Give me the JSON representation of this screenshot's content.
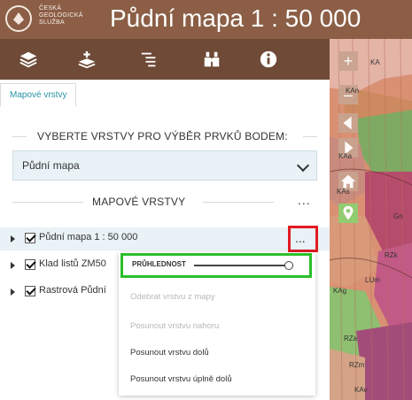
{
  "header": {
    "org_lines": [
      "ČESKÁ",
      "GEOLOGICKÁ",
      "SLUŽBA"
    ],
    "title": "Půdní mapa 1 : 50 000"
  },
  "toolbar": {
    "items": [
      {
        "icon": "layers-icon"
      },
      {
        "icon": "add-layer-icon"
      },
      {
        "icon": "legend-icon"
      },
      {
        "icon": "binoculars-icon"
      },
      {
        "icon": "info-icon"
      }
    ]
  },
  "tabs": {
    "active": "Mapové vrstvy"
  },
  "panel": {
    "select_section_title": "VYBERTE VRSTVY PRO VÝBĚR PRVKŮ BODEM:",
    "selected_layer": "Půdní mapa",
    "layers_section_title": "MAPOVÉ VRSTVY",
    "section_more": "...",
    "layers": [
      {
        "label": "Půdní mapa 1 : 50 000",
        "checked": true
      },
      {
        "label": "Klad listů ZM50",
        "checked": true
      },
      {
        "label": "Rastrová Půdní",
        "checked": true
      }
    ],
    "layer_more": "..."
  },
  "context_menu": {
    "opacity_label": "PRŮHLEDNOST",
    "opacity_value": 0.95,
    "items": [
      {
        "label": "Odebrat vrstvu z mapy",
        "enabled": false
      },
      {
        "label": "Posunout vrstvu nahoru",
        "enabled": false
      },
      {
        "label": "Posunout vrstvu dolů",
        "enabled": true
      },
      {
        "label": "Posunout vrstvu úplně dolů",
        "enabled": true
      }
    ]
  },
  "map": {
    "zoom_in": "+",
    "zoom_out": "–",
    "labels": [
      "KA",
      "KAn",
      "KAa",
      "KAs",
      "Gn",
      "RZk",
      "LUm",
      "KAg",
      "RZa",
      "RZm",
      "KAv"
    ]
  },
  "colors": {
    "header": "#8b5e45",
    "toolbar": "#6e4a37",
    "highlight_red": "#e21b23",
    "highlight_green": "#2bbf2b",
    "tab_text": "#2a93a7"
  }
}
